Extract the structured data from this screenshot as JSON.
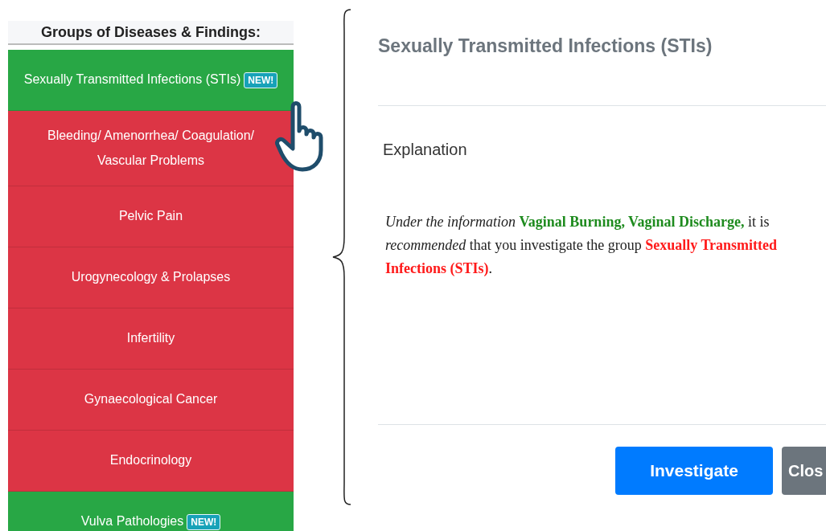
{
  "sidebar": {
    "title": "Groups of Diseases & Findings:",
    "items": [
      {
        "label": "Sexually Transmitted Infections (STIs)",
        "color": "#28a745",
        "badge": "NEW!"
      },
      {
        "label": "Bleeding/ Amenorrhea/ Coagulation/ Vascular Problems",
        "color": "#dc3545"
      },
      {
        "label": "Pelvic Pain",
        "color": "#dc3545"
      },
      {
        "label": "Urogynecology & Prolapses",
        "color": "#dc3545"
      },
      {
        "label": "Infertility",
        "color": "#dc3545"
      },
      {
        "label": "Gynaecological Cancer",
        "color": "#dc3545"
      },
      {
        "label": "Endocrinology",
        "color": "#dc3545"
      },
      {
        "label": "Vulva Pathologies",
        "color": "#28a745",
        "badge": "NEW!"
      }
    ]
  },
  "modal": {
    "title": "Sexually Transmitted Infections (STIs)",
    "section": "Explanation",
    "text": [
      {
        "kind": "emphasis",
        "text": "Under the information"
      },
      {
        "kind": "finding",
        "text": "Vaginal Burning, Vaginal Discharge,"
      },
      {
        "kind": "plain",
        "text": "it is"
      },
      {
        "kind": "emphasis",
        "text": "recommended"
      },
      {
        "kind": "plain",
        "text": "that you investigate the group"
      },
      {
        "kind": "group",
        "text": "Sexually Transmitted Infections (STIs)"
      },
      {
        "kind": "plain",
        "text": "."
      }
    ],
    "buttons": [
      {
        "label": "Investigate",
        "kind": "primary"
      },
      {
        "label": "Clos",
        "kind": "secondary"
      }
    ]
  }
}
